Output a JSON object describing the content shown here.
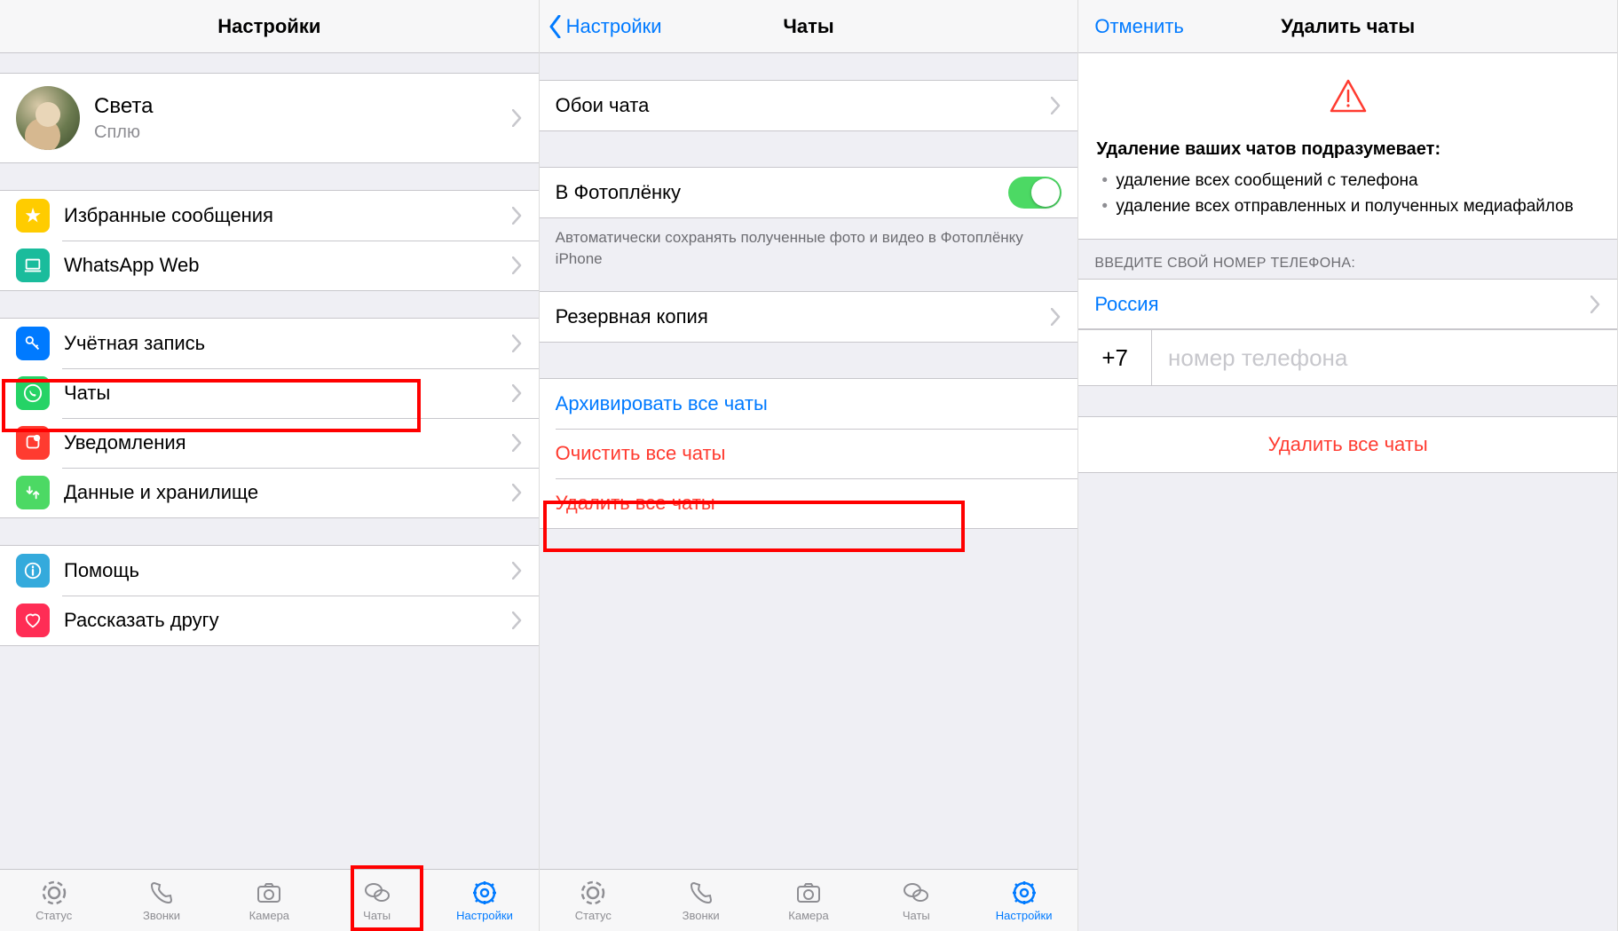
{
  "screens": {
    "settings": {
      "title": "Настройки",
      "profile_name": "Света",
      "profile_status": "Сплю",
      "rows": {
        "starred": "Избранные сообщения",
        "web": "WhatsApp Web",
        "account": "Учётная запись",
        "chats": "Чаты",
        "notifications": "Уведомления",
        "data": "Данные и хранилище",
        "help": "Помощь",
        "tell": "Рассказать другу"
      }
    },
    "chats": {
      "back": "Настройки",
      "title": "Чаты",
      "wallpaper": "Обои чата",
      "cameraroll": "В Фотоплёнку",
      "cameraroll_footer": "Автоматически сохранять полученные фото и видео в Фотоплёнку iPhone",
      "backup": "Резервная копия",
      "archive_all": "Архивировать все чаты",
      "clear_all": "Очистить все чаты",
      "delete_all": "Удалить все чаты"
    },
    "delete": {
      "cancel": "Отменить",
      "title": "Удалить чаты",
      "heading": "Удаление ваших чатов подразумевает:",
      "bullet1": "удаление всех сообщений с телефона",
      "bullet2": "удаление всех отправленных и полученных медиафайлов",
      "enter_label": "ВВЕДИТЕ СВОЙ НОМЕР ТЕЛЕФОНА:",
      "country": "Россия",
      "prefix": "+7",
      "placeholder": "номер телефона",
      "delete_btn": "Удалить все чаты"
    }
  },
  "tabs": {
    "status": "Статус",
    "calls": "Звонки",
    "camera": "Камера",
    "chats": "Чаты",
    "settings": "Настройки"
  }
}
